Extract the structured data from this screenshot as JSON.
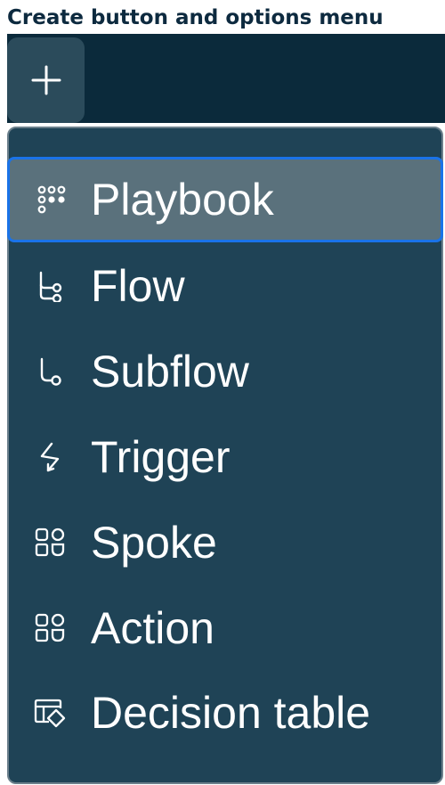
{
  "caption": "Create button and options menu",
  "create_button": {
    "icon": "plus-icon"
  },
  "menu": {
    "items": [
      {
        "label": "Playbook",
        "icon": "playbook-icon",
        "selected": true
      },
      {
        "label": "Flow",
        "icon": "flow-icon",
        "selected": false
      },
      {
        "label": "Subflow",
        "icon": "subflow-icon",
        "selected": false
      },
      {
        "label": "Trigger",
        "icon": "trigger-icon",
        "selected": false
      },
      {
        "label": "Spoke",
        "icon": "spoke-icon",
        "selected": false
      },
      {
        "label": "Action",
        "icon": "action-icon",
        "selected": false
      },
      {
        "label": "Decision table",
        "icon": "decision-table-icon",
        "selected": false
      }
    ]
  },
  "colors": {
    "caption": "#0d2a3f",
    "topbar": "#0b2a3b",
    "create_button_bg": "#2b4b5b",
    "menu_bg": "#1f4356",
    "menu_border": "#6b7f8b",
    "selected_bg": "#5a717c",
    "focus_ring": "#1a73e8",
    "text": "#ffffff"
  }
}
